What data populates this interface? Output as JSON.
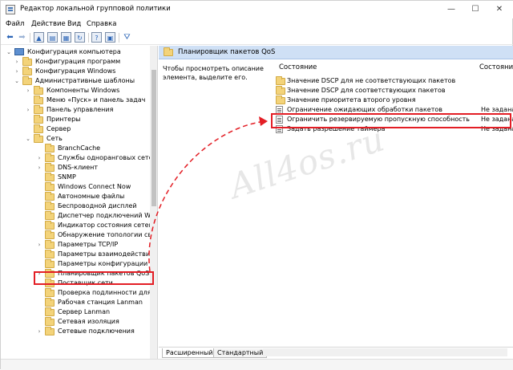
{
  "window": {
    "title": "Редактор локальной групповой политики",
    "controls": {
      "minimize": "—",
      "maximize": "☐",
      "close": "✕"
    }
  },
  "menu": [
    "Файл",
    "Действие",
    "Вид",
    "Справка"
  ],
  "toolbar": {
    "icons": [
      "arrow-left-icon",
      "arrow-right-icon",
      "folder-up-icon",
      "show-hide-tree-icon",
      "export-list-icon",
      "refresh-icon",
      "help-icon",
      "properties-icon",
      "filter-icon"
    ]
  },
  "tree": {
    "items": [
      {
        "label": "Конфигурация компьютера",
        "twisty": "⌄",
        "icon": "computer"
      },
      {
        "label": "Конфигурация программ",
        "twisty": "›",
        "icon": "folder"
      },
      {
        "label": "Конфигурация Windows",
        "twisty": "›",
        "icon": "folder"
      },
      {
        "label": "Административные шаблоны",
        "twisty": "⌄",
        "icon": "folder"
      },
      {
        "label": "Компоненты Windows",
        "twisty": "›",
        "icon": "folder"
      },
      {
        "label": "Меню «Пуск» и панель задач",
        "twisty": "",
        "icon": "folder"
      },
      {
        "label": "Панель управления",
        "twisty": "›",
        "icon": "folder"
      },
      {
        "label": "Принтеры",
        "twisty": "",
        "icon": "folder"
      },
      {
        "label": "Сервер",
        "twisty": "",
        "icon": "folder"
      },
      {
        "label": "Сеть",
        "twisty": "⌄",
        "icon": "folder"
      },
      {
        "label": "BranchCache",
        "twisty": "",
        "icon": "folder"
      },
      {
        "label": "Службы одноранговых сетей",
        "twisty": "›",
        "icon": "folder"
      },
      {
        "label": "DNS-клиент",
        "twisty": "›",
        "icon": "folder"
      },
      {
        "label": "SNMP",
        "twisty": "",
        "icon": "folder"
      },
      {
        "label": "Windows Connect Now",
        "twisty": "",
        "icon": "folder"
      },
      {
        "label": "Автономные файлы",
        "twisty": "",
        "icon": "folder"
      },
      {
        "label": "Беспроводной дисплей",
        "twisty": "",
        "icon": "folder"
      },
      {
        "label": "Диспетчер подключений Win",
        "twisty": "",
        "icon": "folder"
      },
      {
        "label": "Индикатор состояния сетевог",
        "twisty": "",
        "icon": "folder"
      },
      {
        "label": "Обнаружение топологии связ",
        "twisty": "",
        "icon": "folder"
      },
      {
        "label": "Параметры TCP/IP",
        "twisty": "›",
        "icon": "folder"
      },
      {
        "label": "Параметры взаимодействия к",
        "twisty": "",
        "icon": "folder"
      },
      {
        "label": "Параметры конфигурации SS",
        "twisty": "",
        "icon": "folder"
      },
      {
        "label": "Планировщик пакетов QoS",
        "twisty": "›",
        "icon": "folder",
        "selected": true
      },
      {
        "label": "Поставщик сети",
        "twisty": "",
        "icon": "folder"
      },
      {
        "label": "Проверка подлинности для те",
        "twisty": "",
        "icon": "folder"
      },
      {
        "label": "Рабочая станция Lanman",
        "twisty": "",
        "icon": "folder"
      },
      {
        "label": "Сервер Lanman",
        "twisty": "",
        "icon": "folder"
      },
      {
        "label": "Сетевая изоляция",
        "twisty": "",
        "icon": "folder"
      },
      {
        "label": "Сетевые подключения",
        "twisty": "›",
        "icon": "folder"
      }
    ]
  },
  "content": {
    "header": "Планировщик пакетов QoS",
    "description": "Чтобы просмотреть описание элемента, выделите его.",
    "columns": {
      "name": "Состояние",
      "state": "Состояние"
    },
    "rows": [
      {
        "name": "Значение DSCP для не соответствующих пакетов",
        "state": "",
        "type": "folder"
      },
      {
        "name": "Значение DSCP для соответствующих пакетов",
        "state": "",
        "type": "folder"
      },
      {
        "name": "Значение приоритета второго уровня",
        "state": "",
        "type": "folder"
      },
      {
        "name": "Ограничение ожидающих обработки пакетов",
        "state": "Не задана",
        "type": "setting"
      },
      {
        "name": "Ограничить резервируемую пропускную способность",
        "state": "Не задана",
        "type": "setting",
        "highlighted": true
      },
      {
        "name": "Задать разрешение таймера",
        "state": "Не задана",
        "type": "setting"
      }
    ],
    "tabs": [
      "Расширенный",
      "Стандартный"
    ]
  },
  "watermark": "All4os.ru",
  "accent": {
    "highlight": "#e31e25",
    "header": "#cfe0f5",
    "folder": "#f3d37a"
  }
}
